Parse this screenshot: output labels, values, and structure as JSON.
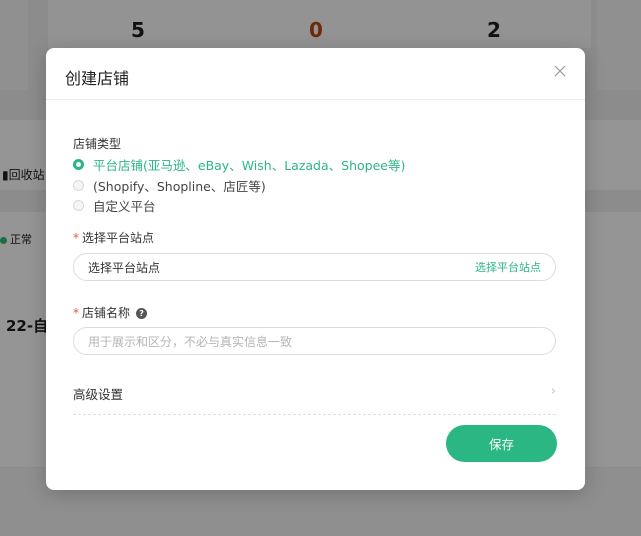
{
  "background": {
    "stats": [
      "5",
      "0",
      "2"
    ],
    "side_recycle": "回收站",
    "side_status": "正常",
    "side_big": "22-自"
  },
  "modal": {
    "title": "创建店铺",
    "close_icon": "close-icon",
    "store_type": {
      "label": "店铺类型",
      "options": [
        {
          "label": "平台店铺(亚马逊、eBay、Wish、Lazada、Shopee等)",
          "checked": true
        },
        {
          "label": "(Shopify、Shopline、店匠等)",
          "checked": false
        },
        {
          "label": "自定义平台",
          "checked": false
        }
      ]
    },
    "site": {
      "required_mark": "*",
      "label": "选择平台站点",
      "value": "选择平台站点",
      "action": "选择平台站点"
    },
    "store_name": {
      "required_mark": "*",
      "label": "店铺名称",
      "help_icon": "?",
      "placeholder": "用于展示和区分，不必与真实信息一致"
    },
    "advanced": {
      "label": "高级设置",
      "chevron": "›"
    },
    "save_label": "保存",
    "accent_color": "#2bb784"
  }
}
